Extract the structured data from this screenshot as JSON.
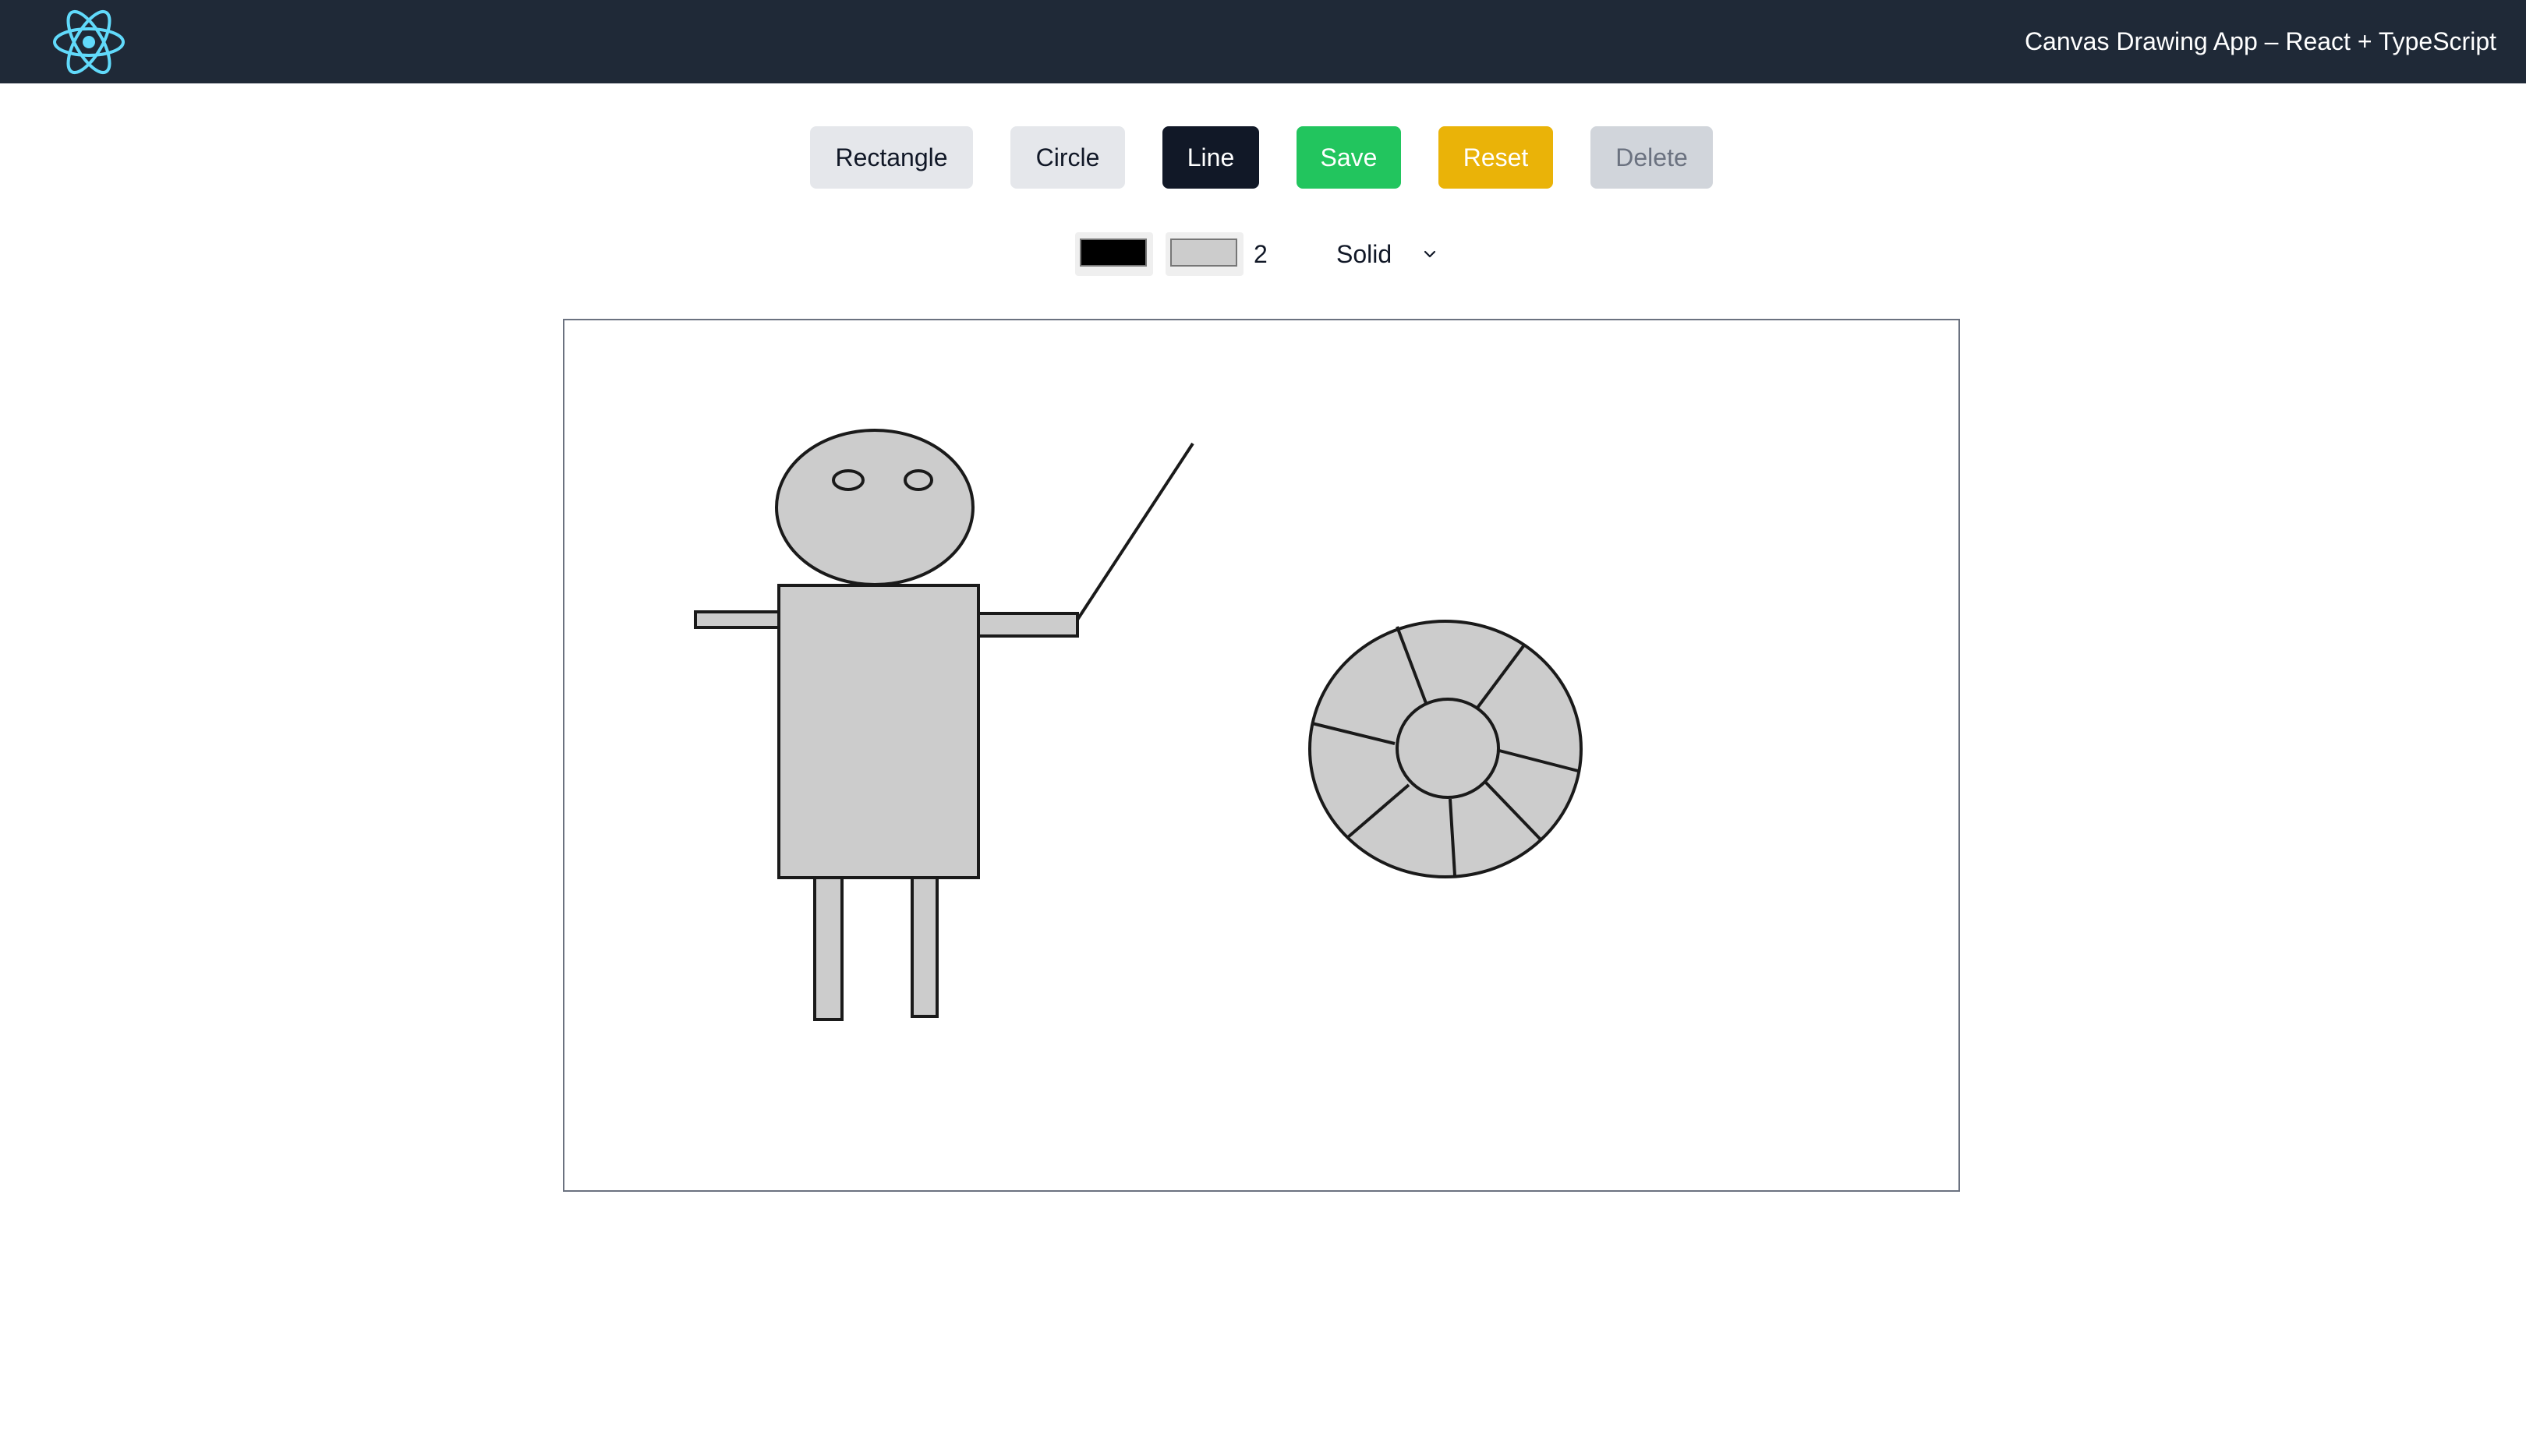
{
  "header": {
    "title": "Canvas Drawing App – React + TypeScript",
    "logo_icon": "react-atom-icon",
    "logo_color": "#61dafb",
    "background": "#1f2937"
  },
  "toolbar": {
    "rectangle_label": "Rectangle",
    "circle_label": "Circle",
    "line_label": "Line",
    "save_label": "Save",
    "reset_label": "Reset",
    "delete_label": "Delete",
    "active_tool": "Line",
    "colors": {
      "tool_button": "#e5e7eb",
      "active_tool": "#111827",
      "save": "#22c55e",
      "reset": "#eab308",
      "delete_disabled": "#d1d5db"
    }
  },
  "controls": {
    "stroke_color": "#000000",
    "fill_color": "#cccccc",
    "stroke_width": "2",
    "stroke_style": "Solid"
  },
  "canvas": {
    "background": "#ffffff",
    "shape_fill": "#cccccc",
    "shape_stroke": "#1a1a1a"
  }
}
